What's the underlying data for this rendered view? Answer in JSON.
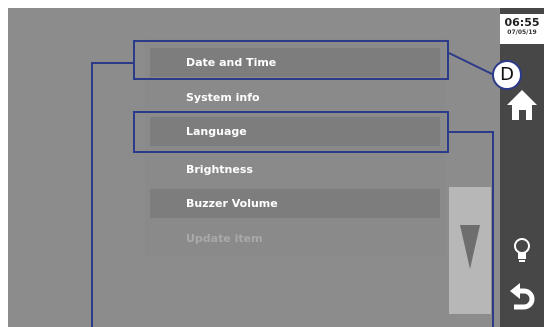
{
  "clock": {
    "time": "06:55",
    "date": "07/05/19"
  },
  "menu": {
    "items": [
      {
        "label": "Date and Time"
      },
      {
        "label": "System info"
      },
      {
        "label": "Language"
      },
      {
        "label": "Brightness"
      },
      {
        "label": "Buzzer Volume"
      },
      {
        "label": "Update item"
      }
    ]
  },
  "callout": {
    "label": "D"
  },
  "icons": {
    "home": "home-icon",
    "bulb": "lightbulb-icon",
    "back": "back-arrow-icon",
    "scroll": "triangle-down-icon"
  }
}
